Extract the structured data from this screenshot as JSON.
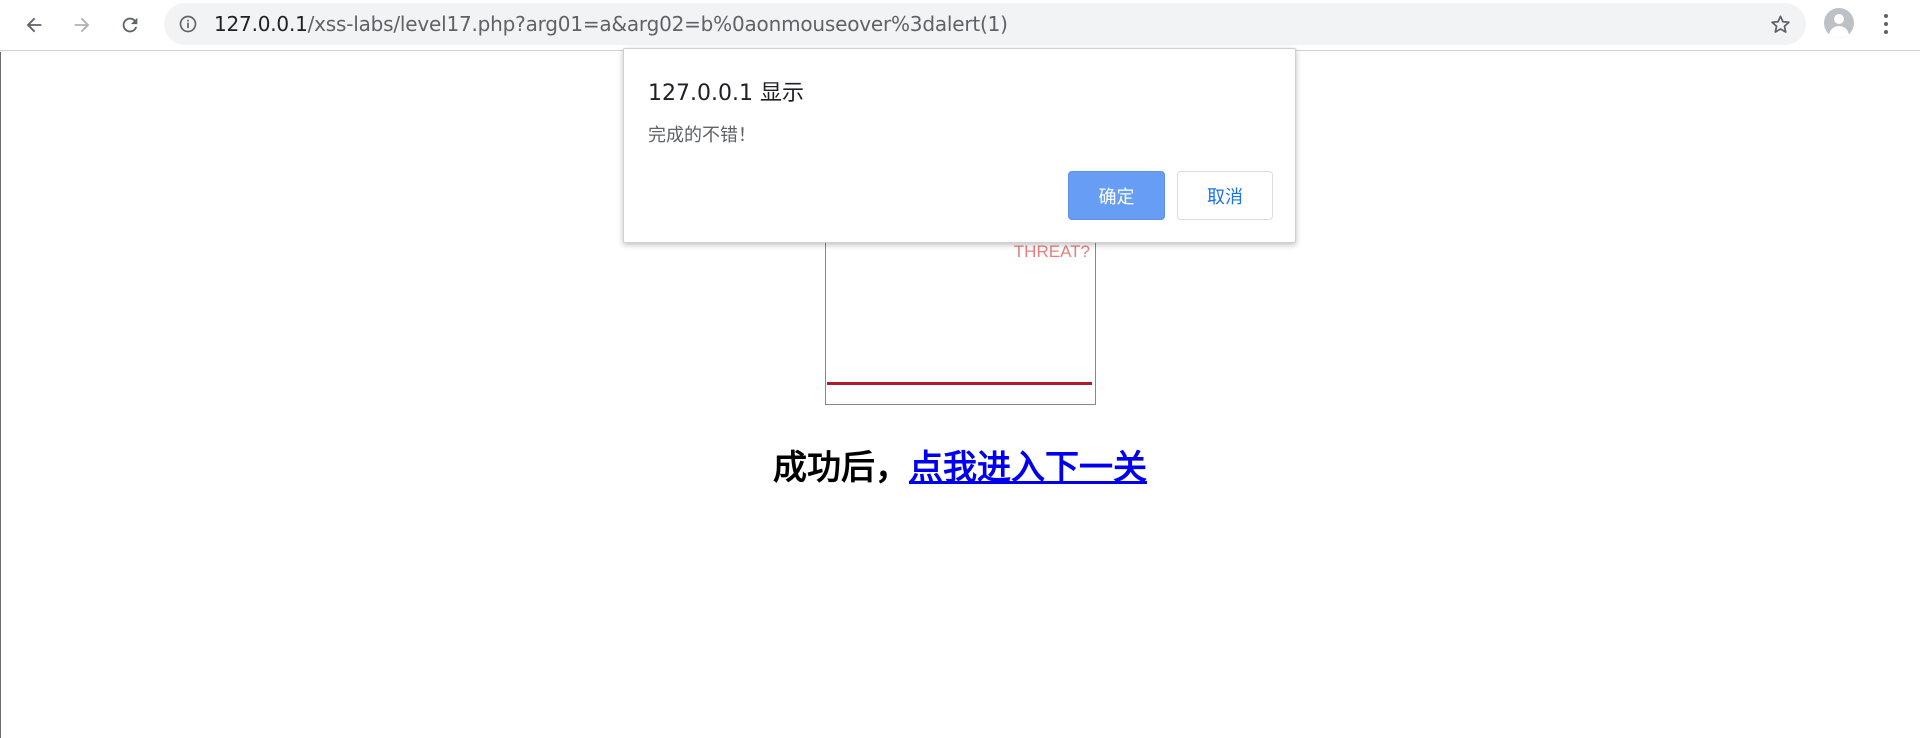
{
  "browser": {
    "url_host": "127.0.0.1",
    "url_path": "/xss-labs/level17.php?arg01=a&arg02=b%0aonmouseover%3dalert(1)",
    "icons": {
      "back": "back-arrow-icon",
      "forward": "forward-arrow-icon",
      "reload": "reload-icon",
      "site_info": "info-icon",
      "bookmark": "star-icon",
      "profile": "profile-avatar-icon",
      "menu": "menu-dots-icon"
    }
  },
  "dialog": {
    "title": "127.0.0.1 显示",
    "message": "完成的不错！",
    "ok_label": "确定",
    "cancel_label": "取消",
    "accent_color": "#689df6"
  },
  "page": {
    "embed_text": "THREAT?",
    "heading_prefix": "成功后，",
    "next_level_link": "点我进入下一关"
  }
}
